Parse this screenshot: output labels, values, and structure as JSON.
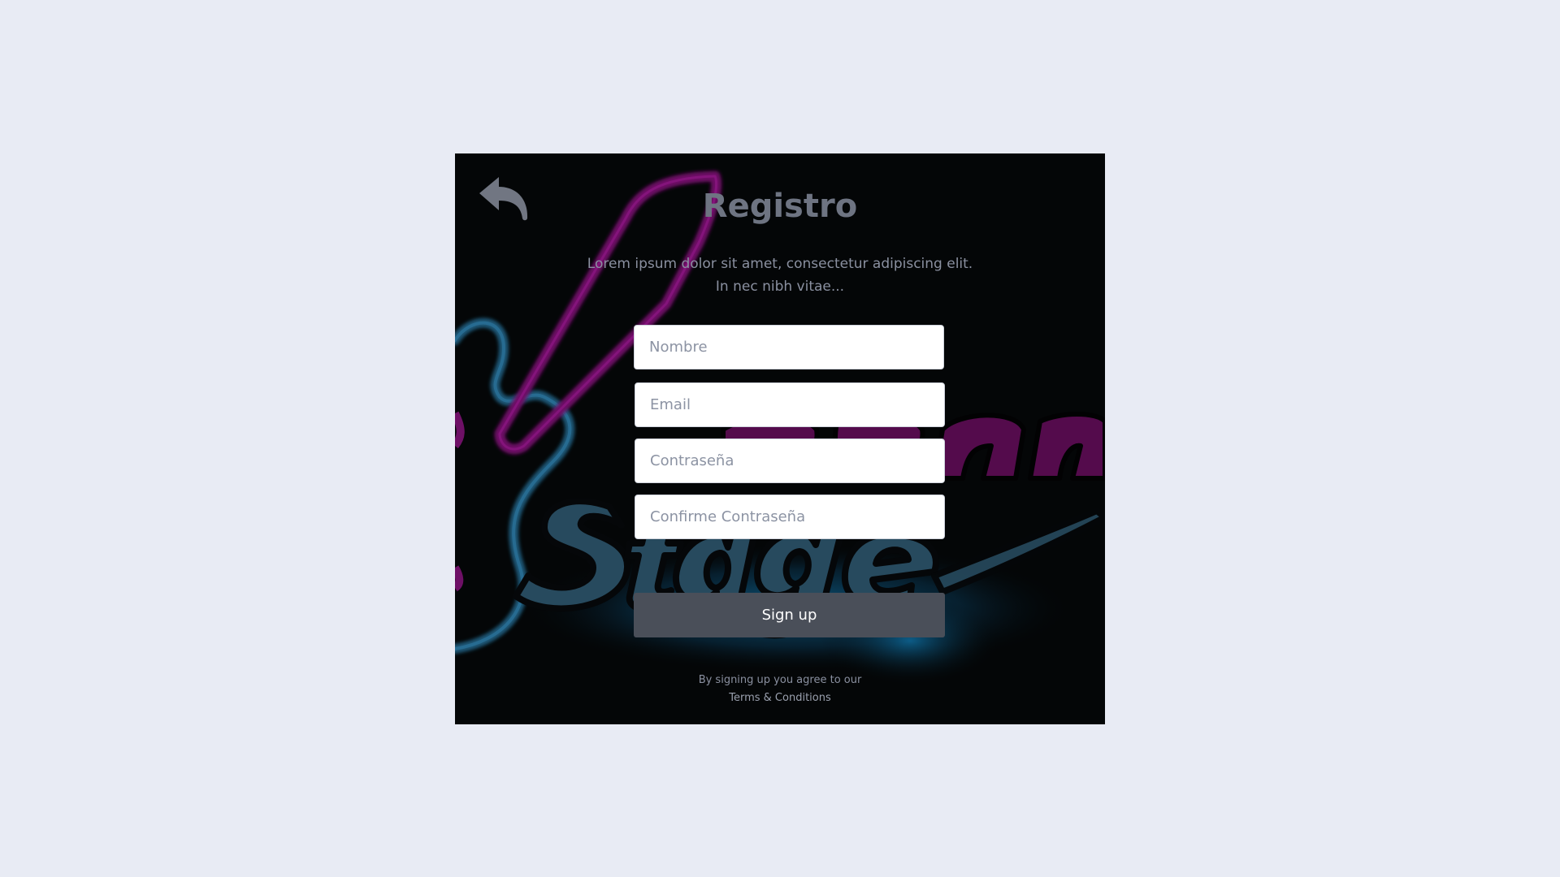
{
  "header": {
    "back_icon": "reply-arrow-icon",
    "title": "Registro",
    "description": "Lorem ipsum dolor sit amet, consectetur adipiscing elit. In nec nibh vitae..."
  },
  "form": {
    "name_placeholder": "Nombre",
    "email_placeholder": "Email",
    "password_placeholder": "Contraseña",
    "confirm_password_placeholder": "Confirme Contraseña",
    "submit_label": "Sign up"
  },
  "footer": {
    "agree_text": "By signing up you agree to our",
    "terms_link": "Terms & Conditions"
  },
  "colors": {
    "page_background": "#e8ebf4",
    "card_background": "#040607",
    "button_background": "#4a4f59",
    "neon_magenta": "#7a1270",
    "neon_blue": "#1e5a7e"
  }
}
